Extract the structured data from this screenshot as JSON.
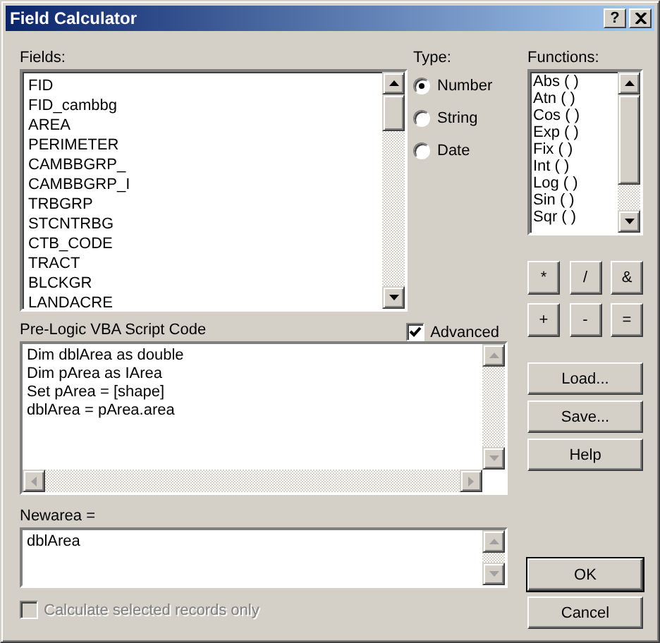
{
  "window": {
    "title": "Field Calculator",
    "help_button": "?"
  },
  "fields": {
    "label": "Fields:",
    "items": [
      "FID",
      "FID_cambbg",
      "AREA",
      "PERIMETER",
      "CAMBBGRP_",
      "CAMBBGRP_I",
      "TRBGRP",
      "STCNTRBG",
      "CTB_CODE",
      "TRACT",
      "BLCKGR",
      "LANDACRE"
    ]
  },
  "type": {
    "label": "Type:",
    "options": [
      {
        "label": "Number",
        "selected": true
      },
      {
        "label": "String",
        "selected": false
      },
      {
        "label": "Date",
        "selected": false
      }
    ]
  },
  "functions": {
    "label": "Functions:",
    "items": [
      "Abs ( )",
      "Atn ( )",
      "Cos ( )",
      "Exp ( )",
      "Fix ( )",
      "Int ( )",
      "Log ( )",
      "Sin ( )",
      "Sqr ( )"
    ]
  },
  "operators": [
    "*",
    "/",
    "&",
    "+",
    "-",
    "="
  ],
  "prelogic": {
    "label": "Pre-Logic VBA Script Code",
    "advanced": {
      "label": "Advanced",
      "checked": true
    },
    "lines": [
      "Dim dblArea as double",
      "Dim pArea as IArea",
      "Set pArea = [shape]",
      "dblArea = pArea.area"
    ]
  },
  "expression": {
    "label": "Newarea =",
    "value": "dblArea"
  },
  "calculate_selected": {
    "label": "Calculate selected records only",
    "checked": false,
    "disabled": true
  },
  "side_buttons": [
    {
      "label": "Load...",
      "default": false
    },
    {
      "label": "Save...",
      "default": false
    },
    {
      "label": "Help",
      "default": false
    }
  ],
  "dialog_buttons": [
    {
      "label": "OK",
      "default": true
    },
    {
      "label": "Cancel",
      "default": false
    }
  ]
}
